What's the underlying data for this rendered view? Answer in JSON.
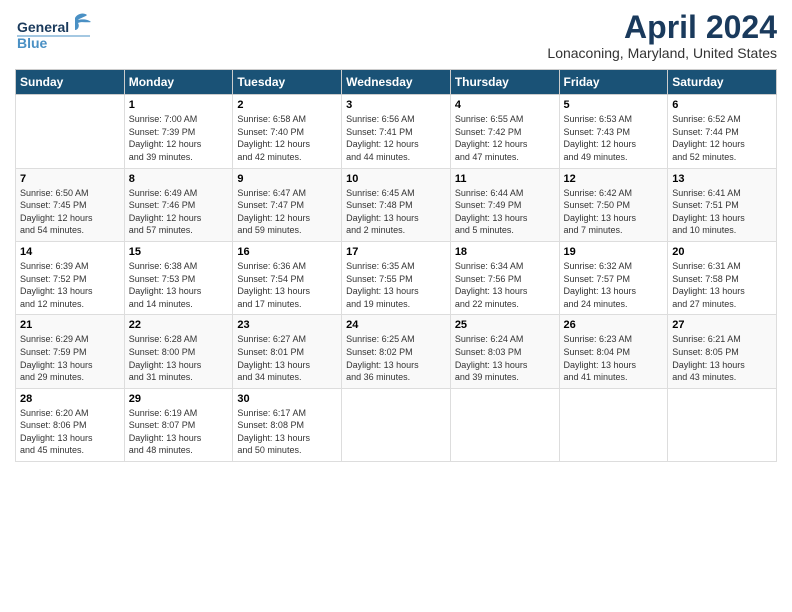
{
  "logo": {
    "line1": "General",
    "line2": "Blue"
  },
  "header": {
    "title": "April 2024",
    "subtitle": "Lonaconing, Maryland, United States"
  },
  "weekdays": [
    "Sunday",
    "Monday",
    "Tuesday",
    "Wednesday",
    "Thursday",
    "Friday",
    "Saturday"
  ],
  "weeks": [
    [
      {
        "day": "",
        "info": ""
      },
      {
        "day": "1",
        "info": "Sunrise: 7:00 AM\nSunset: 7:39 PM\nDaylight: 12 hours\nand 39 minutes."
      },
      {
        "day": "2",
        "info": "Sunrise: 6:58 AM\nSunset: 7:40 PM\nDaylight: 12 hours\nand 42 minutes."
      },
      {
        "day": "3",
        "info": "Sunrise: 6:56 AM\nSunset: 7:41 PM\nDaylight: 12 hours\nand 44 minutes."
      },
      {
        "day": "4",
        "info": "Sunrise: 6:55 AM\nSunset: 7:42 PM\nDaylight: 12 hours\nand 47 minutes."
      },
      {
        "day": "5",
        "info": "Sunrise: 6:53 AM\nSunset: 7:43 PM\nDaylight: 12 hours\nand 49 minutes."
      },
      {
        "day": "6",
        "info": "Sunrise: 6:52 AM\nSunset: 7:44 PM\nDaylight: 12 hours\nand 52 minutes."
      }
    ],
    [
      {
        "day": "7",
        "info": "Sunrise: 6:50 AM\nSunset: 7:45 PM\nDaylight: 12 hours\nand 54 minutes."
      },
      {
        "day": "8",
        "info": "Sunrise: 6:49 AM\nSunset: 7:46 PM\nDaylight: 12 hours\nand 57 minutes."
      },
      {
        "day": "9",
        "info": "Sunrise: 6:47 AM\nSunset: 7:47 PM\nDaylight: 12 hours\nand 59 minutes."
      },
      {
        "day": "10",
        "info": "Sunrise: 6:45 AM\nSunset: 7:48 PM\nDaylight: 13 hours\nand 2 minutes."
      },
      {
        "day": "11",
        "info": "Sunrise: 6:44 AM\nSunset: 7:49 PM\nDaylight: 13 hours\nand 5 minutes."
      },
      {
        "day": "12",
        "info": "Sunrise: 6:42 AM\nSunset: 7:50 PM\nDaylight: 13 hours\nand 7 minutes."
      },
      {
        "day": "13",
        "info": "Sunrise: 6:41 AM\nSunset: 7:51 PM\nDaylight: 13 hours\nand 10 minutes."
      }
    ],
    [
      {
        "day": "14",
        "info": "Sunrise: 6:39 AM\nSunset: 7:52 PM\nDaylight: 13 hours\nand 12 minutes."
      },
      {
        "day": "15",
        "info": "Sunrise: 6:38 AM\nSunset: 7:53 PM\nDaylight: 13 hours\nand 14 minutes."
      },
      {
        "day": "16",
        "info": "Sunrise: 6:36 AM\nSunset: 7:54 PM\nDaylight: 13 hours\nand 17 minutes."
      },
      {
        "day": "17",
        "info": "Sunrise: 6:35 AM\nSunset: 7:55 PM\nDaylight: 13 hours\nand 19 minutes."
      },
      {
        "day": "18",
        "info": "Sunrise: 6:34 AM\nSunset: 7:56 PM\nDaylight: 13 hours\nand 22 minutes."
      },
      {
        "day": "19",
        "info": "Sunrise: 6:32 AM\nSunset: 7:57 PM\nDaylight: 13 hours\nand 24 minutes."
      },
      {
        "day": "20",
        "info": "Sunrise: 6:31 AM\nSunset: 7:58 PM\nDaylight: 13 hours\nand 27 minutes."
      }
    ],
    [
      {
        "day": "21",
        "info": "Sunrise: 6:29 AM\nSunset: 7:59 PM\nDaylight: 13 hours\nand 29 minutes."
      },
      {
        "day": "22",
        "info": "Sunrise: 6:28 AM\nSunset: 8:00 PM\nDaylight: 13 hours\nand 31 minutes."
      },
      {
        "day": "23",
        "info": "Sunrise: 6:27 AM\nSunset: 8:01 PM\nDaylight: 13 hours\nand 34 minutes."
      },
      {
        "day": "24",
        "info": "Sunrise: 6:25 AM\nSunset: 8:02 PM\nDaylight: 13 hours\nand 36 minutes."
      },
      {
        "day": "25",
        "info": "Sunrise: 6:24 AM\nSunset: 8:03 PM\nDaylight: 13 hours\nand 39 minutes."
      },
      {
        "day": "26",
        "info": "Sunrise: 6:23 AM\nSunset: 8:04 PM\nDaylight: 13 hours\nand 41 minutes."
      },
      {
        "day": "27",
        "info": "Sunrise: 6:21 AM\nSunset: 8:05 PM\nDaylight: 13 hours\nand 43 minutes."
      }
    ],
    [
      {
        "day": "28",
        "info": "Sunrise: 6:20 AM\nSunset: 8:06 PM\nDaylight: 13 hours\nand 45 minutes."
      },
      {
        "day": "29",
        "info": "Sunrise: 6:19 AM\nSunset: 8:07 PM\nDaylight: 13 hours\nand 48 minutes."
      },
      {
        "day": "30",
        "info": "Sunrise: 6:17 AM\nSunset: 8:08 PM\nDaylight: 13 hours\nand 50 minutes."
      },
      {
        "day": "",
        "info": ""
      },
      {
        "day": "",
        "info": ""
      },
      {
        "day": "",
        "info": ""
      },
      {
        "day": "",
        "info": ""
      }
    ]
  ]
}
